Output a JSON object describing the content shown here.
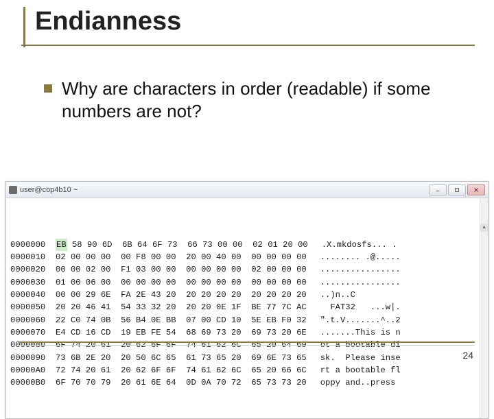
{
  "title": "Endianness",
  "bullet": "Why are characters in order (readable) if some numbers are not?",
  "window": {
    "title": "user@cop4b10 ~",
    "buttons": {
      "min": "minimize",
      "max": "maximize",
      "close": "close"
    }
  },
  "hex": {
    "rows": [
      {
        "off": "0000000",
        "first": "EB",
        "bytes": "58 90 6D  6B 64 6F 73  66 73 00 00  02 01 20 00",
        "asc": ".X.mkdosfs... ."
      },
      {
        "off": "0000010",
        "first": "02",
        "bytes": "00 00 00  00 F8 00 00  20 00 40 00  00 00 00 00",
        "asc": "........ .@....."
      },
      {
        "off": "0000020",
        "first": "00",
        "bytes": "00 02 00  F1 03 00 00  00 00 00 00  02 00 00 00",
        "asc": "................"
      },
      {
        "off": "0000030",
        "first": "01",
        "bytes": "00 06 00  00 00 00 00  00 00 00 00  00 00 00 00",
        "asc": "................"
      },
      {
        "off": "0000040",
        "first": "00",
        "bytes": "00 29 6E  FA 2E 43 20  20 20 20 20  20 20 20 20",
        "asc": "..)n..C         "
      },
      {
        "off": "0000050",
        "first": "20",
        "bytes": "20 46 41  54 33 32 20  20 20 0E 1F  BE 77 7C AC",
        "asc": "  FAT32   ...w|."
      },
      {
        "off": "0000060",
        "first": "22",
        "bytes": "C0 74 0B  56 B4 0E BB  07 00 CD 10  5E EB F0 32",
        "asc": "\".t.V.......^..2"
      },
      {
        "off": "0000070",
        "first": "E4",
        "bytes": "CD 16 CD  19 EB FE 54  68 69 73 20  69 73 20 6E",
        "asc": ".......This is n"
      },
      {
        "off": "0000080",
        "first": "6F",
        "bytes": "74 20 61  20 62 6F 6F  74 61 62 6C  65 20 64 69",
        "asc": "ot a bootable di"
      },
      {
        "off": "0000090",
        "first": "73",
        "bytes": "6B 2E 20  20 50 6C 65  61 73 65 20  69 6E 73 65",
        "asc": "sk.  Please inse"
      },
      {
        "off": "00000A0",
        "first": "72",
        "bytes": "74 20 61  20 62 6F 6F  74 61 62 6C  65 20 66 6C",
        "asc": "rt a bootable fl"
      },
      {
        "off": "00000B0",
        "first": "6F",
        "bytes": "70 70 79  20 61 6E 64  0D 0A 70 72  65 73 73 20",
        "asc": "oppy and..press "
      }
    ]
  },
  "page_number": "24"
}
